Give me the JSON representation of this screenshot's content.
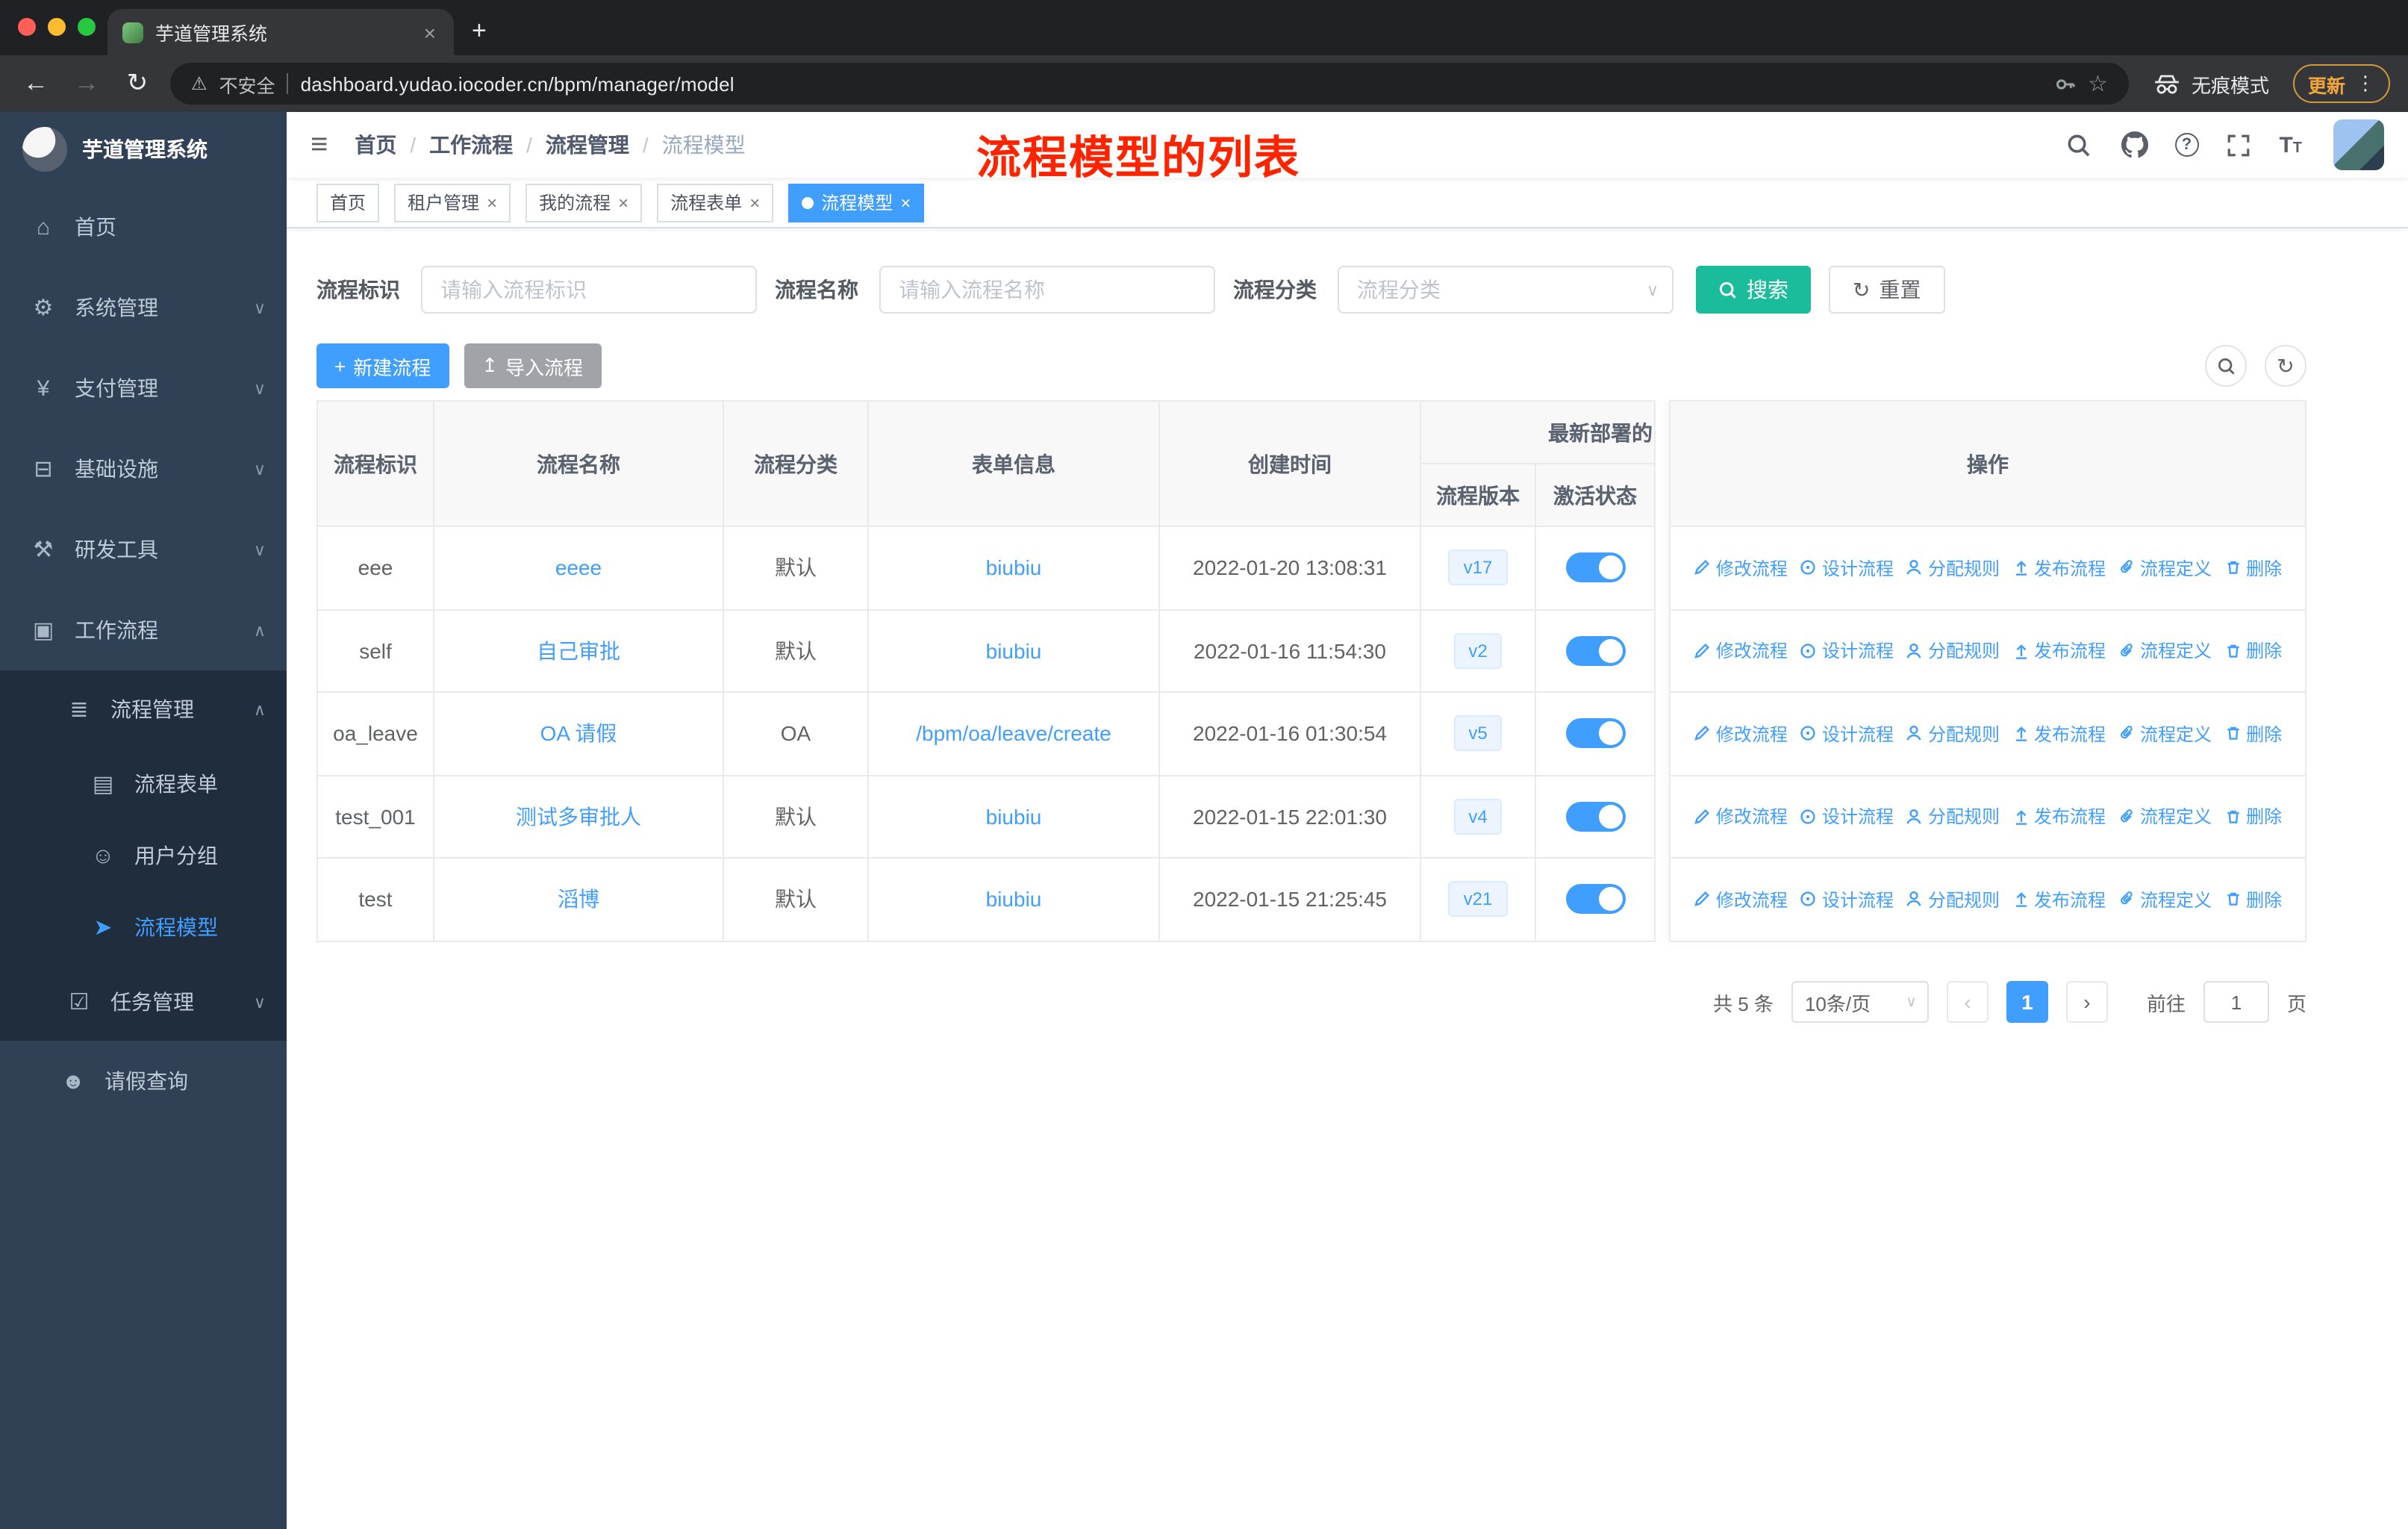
{
  "browser": {
    "tab_title": "芋道管理系统",
    "security_label": "不安全",
    "url": "dashboard.yudao.iocoder.cn/bpm/manager/model",
    "incognito_label": "无痕模式",
    "update_label": "更新"
  },
  "icons": {
    "back": "←",
    "forward": "→",
    "reload": "↻",
    "warning": "⚠",
    "star": "☆",
    "menu_dots": "⋮",
    "close": "×",
    "new_tab": "+",
    "hamburger": "≡",
    "help": "?",
    "font_large": "T",
    "font_small": "T",
    "home": "⌂",
    "system": "⚙",
    "payment": "¥",
    "infra": "⊟",
    "devtools": "⚒",
    "workflow": "▣",
    "process_mgmt": "≣",
    "form": "▤",
    "user_group": "☺",
    "model": "➤",
    "task": "☑",
    "user": "☻",
    "chevron_down": "∨",
    "chevron_up": "∧",
    "plus": "+",
    "upload": "↥",
    "refresh": "↻",
    "chevron_left": "‹",
    "chevron_right": "›"
  },
  "sidebar": {
    "logo_title": "芋道管理系统",
    "items": [
      {
        "label": "首页"
      },
      {
        "label": "系统管理"
      },
      {
        "label": "支付管理"
      },
      {
        "label": "基础设施"
      },
      {
        "label": "研发工具"
      },
      {
        "label": "工作流程"
      },
      {
        "label": "流程管理"
      },
      {
        "label": "流程表单"
      },
      {
        "label": "用户分组"
      },
      {
        "label": "流程模型"
      },
      {
        "label": "任务管理"
      },
      {
        "label": "请假查询"
      }
    ]
  },
  "navbar": {
    "breadcrumb": [
      "首页",
      "工作流程",
      "流程管理",
      "流程模型"
    ],
    "annotation": "流程模型的列表"
  },
  "tags": [
    {
      "label": "首页"
    },
    {
      "label": "租户管理"
    },
    {
      "label": "我的流程"
    },
    {
      "label": "流程表单"
    },
    {
      "label": "流程模型"
    }
  ],
  "filters": {
    "key_label": "流程标识",
    "key_placeholder": "请输入流程标识",
    "name_label": "流程名称",
    "name_placeholder": "请输入流程名称",
    "category_label": "流程分类",
    "category_placeholder": "流程分类",
    "search_button": "搜索",
    "reset_button": "重置"
  },
  "actions_bar": {
    "create_button": "新建流程",
    "import_button": "导入流程"
  },
  "table": {
    "headers": {
      "key": "流程标识",
      "name": "流程名称",
      "category": "流程分类",
      "form": "表单信息",
      "created": "创建时间",
      "deploy_group": "最新部署的",
      "version": "流程版本",
      "status": "激活状态",
      "ops": "操作"
    },
    "actions": [
      {
        "label": "修改流程"
      },
      {
        "label": "设计流程"
      },
      {
        "label": "分配规则"
      },
      {
        "label": "发布流程"
      },
      {
        "label": "流程定义"
      },
      {
        "label": "删除"
      }
    ],
    "rows": [
      {
        "key": "eee",
        "name": "eeee",
        "category": "默认",
        "form": "biubiu",
        "created": "2022-01-20 13:08:31",
        "version": "v17"
      },
      {
        "key": "self",
        "name": "自己审批",
        "category": "默认",
        "form": "biubiu",
        "created": "2022-01-16 11:54:30",
        "version": "v2"
      },
      {
        "key": "oa_leave",
        "name": "OA 请假",
        "category": "OA",
        "form": "/bpm/oa/leave/create",
        "created": "2022-01-16 01:30:54",
        "version": "v5"
      },
      {
        "key": "test_001",
        "name": "测试多审批人",
        "category": "默认",
        "form": "biubiu",
        "created": "2022-01-15 22:01:30",
        "version": "v4"
      },
      {
        "key": "test",
        "name": "滔博",
        "category": "默认",
        "form": "biubiu",
        "created": "2022-01-15 21:25:45",
        "version": "v21"
      }
    ]
  },
  "pagination": {
    "total": "共 5 条",
    "page_size": "10条/页",
    "page": "1",
    "goto_label": "前往",
    "goto_value": "1",
    "page_unit": "页"
  },
  "colors": {
    "primary": "#409eff",
    "search_green": "#1abc9c",
    "sidebar_bg": "#304156",
    "submenu_bg": "#1f2d3d",
    "annotation_red": "#fe2400"
  }
}
